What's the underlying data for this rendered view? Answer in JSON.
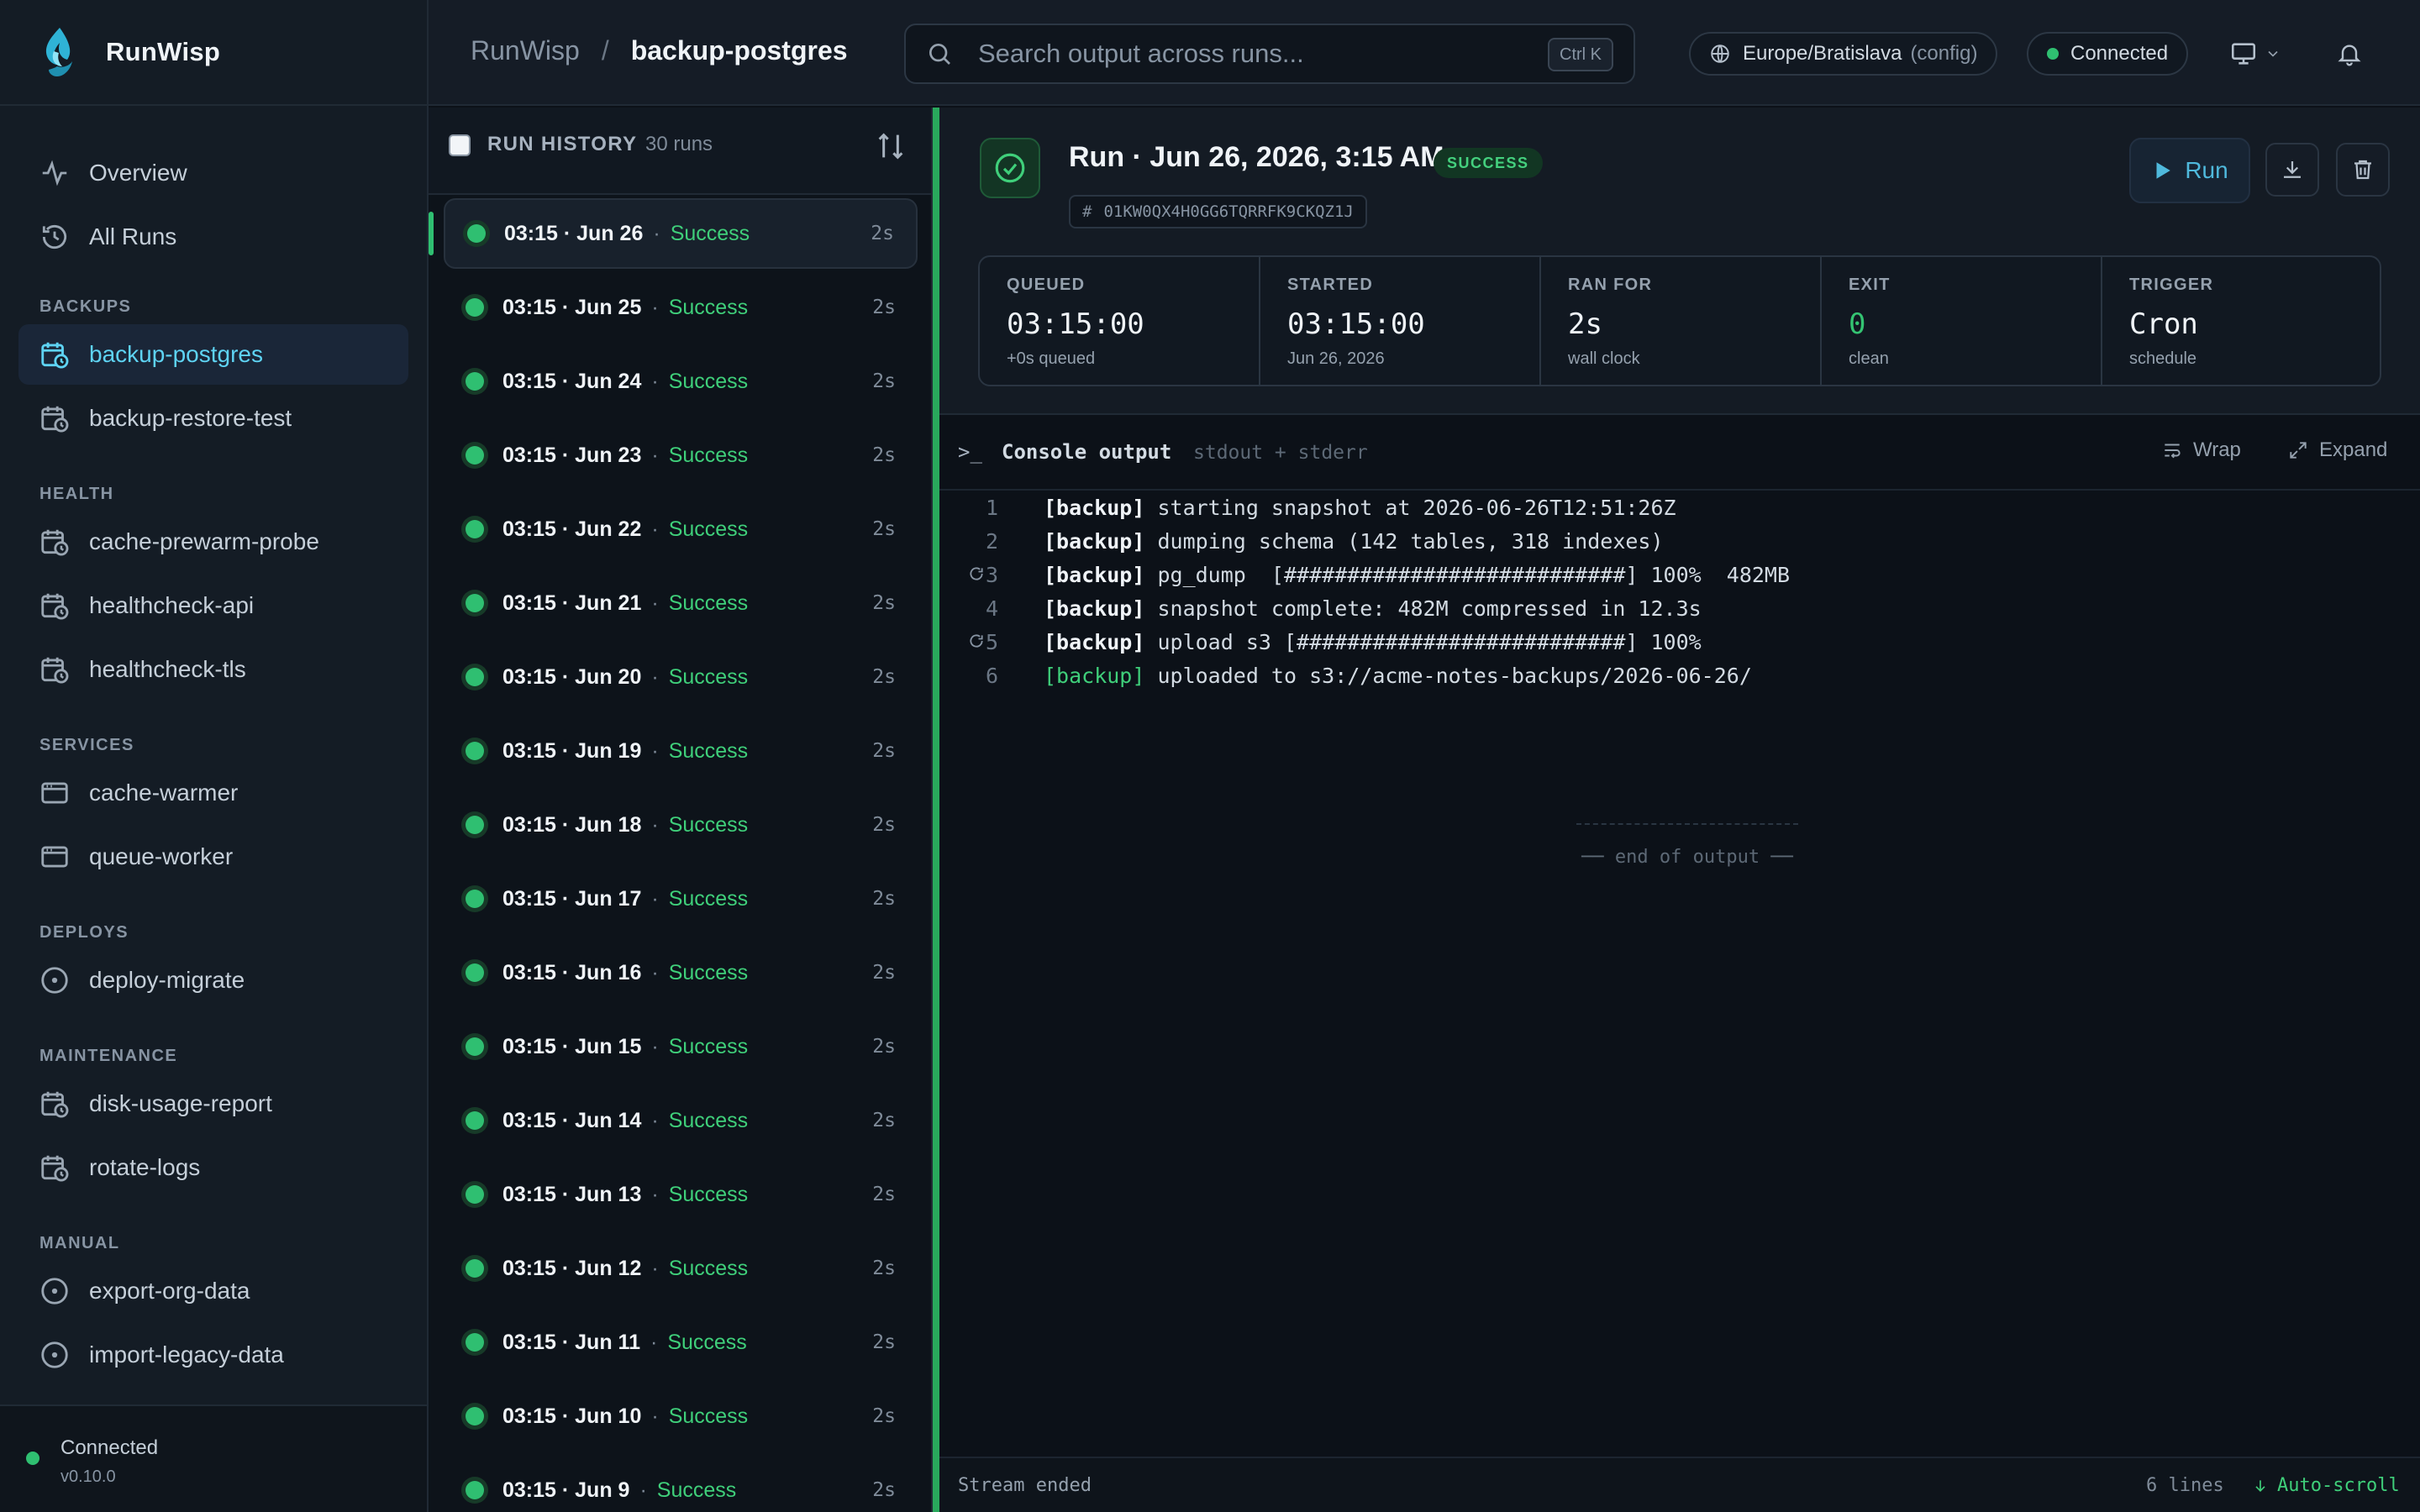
{
  "app": {
    "name": "RunWisp"
  },
  "sidebar": {
    "top_items": [
      {
        "label": "Overview",
        "icon": "activity-icon"
      },
      {
        "label": "All Runs",
        "icon": "history-icon"
      }
    ],
    "sections": [
      {
        "title": "BACKUPS",
        "items": [
          "backup-postgres",
          "backup-restore-test"
        ]
      },
      {
        "title": "HEALTH",
        "items": [
          "cache-prewarm-probe",
          "healthcheck-api",
          "healthcheck-tls"
        ]
      },
      {
        "title": "SERVICES",
        "items": [
          "cache-warmer",
          "queue-worker"
        ]
      },
      {
        "title": "DEPLOYS",
        "items": [
          "deploy-migrate"
        ]
      },
      {
        "title": "MAINTENANCE",
        "items": [
          "disk-usage-report",
          "rotate-logs"
        ]
      },
      {
        "title": "MANUAL",
        "items": [
          "export-org-data",
          "import-legacy-data"
        ]
      }
    ],
    "footer": {
      "status": "Connected",
      "version": "v0.10.0"
    }
  },
  "topbar": {
    "breadcrumb": {
      "root": "RunWisp",
      "separator": "/",
      "current": "backup-postgres"
    },
    "search": {
      "placeholder": "Search output across runs...",
      "shortcut": "Ctrl K"
    },
    "timezone": {
      "label": "Europe/Bratislava",
      "source": "(config)"
    },
    "connection": {
      "label": "Connected"
    }
  },
  "history": {
    "title": "RUN HISTORY",
    "count": "30 runs",
    "runs": [
      {
        "time": "03:15 · Jun 26",
        "status": "Success",
        "duration": "2s"
      },
      {
        "time": "03:15 · Jun 25",
        "status": "Success",
        "duration": "2s"
      },
      {
        "time": "03:15 · Jun 24",
        "status": "Success",
        "duration": "2s"
      },
      {
        "time": "03:15 · Jun 23",
        "status": "Success",
        "duration": "2s"
      },
      {
        "time": "03:15 · Jun 22",
        "status": "Success",
        "duration": "2s"
      },
      {
        "time": "03:15 · Jun 21",
        "status": "Success",
        "duration": "2s"
      },
      {
        "time": "03:15 · Jun 20",
        "status": "Success",
        "duration": "2s"
      },
      {
        "time": "03:15 · Jun 19",
        "status": "Success",
        "duration": "2s"
      },
      {
        "time": "03:15 · Jun 18",
        "status": "Success",
        "duration": "2s"
      },
      {
        "time": "03:15 · Jun 17",
        "status": "Success",
        "duration": "2s"
      },
      {
        "time": "03:15 · Jun 16",
        "status": "Success",
        "duration": "2s"
      },
      {
        "time": "03:15 · Jun 15",
        "status": "Success",
        "duration": "2s"
      },
      {
        "time": "03:15 · Jun 14",
        "status": "Success",
        "duration": "2s"
      },
      {
        "time": "03:15 · Jun 13",
        "status": "Success",
        "duration": "2s"
      },
      {
        "time": "03:15 · Jun 12",
        "status": "Success",
        "duration": "2s"
      },
      {
        "time": "03:15 · Jun 11",
        "status": "Success",
        "duration": "2s"
      },
      {
        "time": "03:15 · Jun 10",
        "status": "Success",
        "duration": "2s"
      },
      {
        "time": "03:15 · Jun 9",
        "status": "Success",
        "duration": "2s"
      }
    ]
  },
  "run": {
    "title": "Run · Jun 26, 2026, 3:15 AM",
    "badge": "SUCCESS",
    "id": "01KW0QX4H0GG6TQRRFK9CKQZ1J",
    "run_button": "Run",
    "stats": [
      {
        "label": "QUEUED",
        "value": "03:15:00",
        "sub": "+0s queued",
        "mono": true
      },
      {
        "label": "STARTED",
        "value": "03:15:00",
        "sub": "Jun 26, 2026",
        "mono": true
      },
      {
        "label": "RAN FOR",
        "value": "2s",
        "sub": "wall clock",
        "mono": true
      },
      {
        "label": "EXIT",
        "value": "0",
        "sub": "clean",
        "mono": true
      },
      {
        "label": "TRIGGER",
        "value": "Cron",
        "sub": "schedule",
        "mono": true
      }
    ]
  },
  "console": {
    "prompt": ">_",
    "title": "Console output",
    "subtitle": "stdout + stderr",
    "wrap_label": "Wrap",
    "expand_label": "Expand",
    "lines": [
      {
        "num": "1",
        "tag": "[backup]",
        "text": " starting snapshot at 2026-06-26T12:51:26Z",
        "retry": false,
        "tag_green": false
      },
      {
        "num": "2",
        "tag": "[backup]",
        "text": " dumping schema (142 tables, 318 indexes)",
        "retry": false,
        "tag_green": false
      },
      {
        "num": "3",
        "tag": "[backup]",
        "text": " pg_dump  [###########################] 100%  482MB",
        "retry": true,
        "tag_green": false
      },
      {
        "num": "4",
        "tag": "[backup]",
        "text": " snapshot complete: 482M compressed in 12.3s",
        "retry": false,
        "tag_green": false
      },
      {
        "num": "5",
        "tag": "[backup]",
        "text": " upload s3 [##########################] 100%",
        "retry": true,
        "tag_green": false
      },
      {
        "num": "6",
        "tag": "[backup]",
        "text": " uploaded to s3://acme-notes-backups/2026-06-26/",
        "retry": false,
        "tag_green": true
      }
    ],
    "end_marker": "── end of output ──",
    "footer": {
      "status": "Stream ended",
      "line_count": "6 lines",
      "autoscroll": "Auto-scroll"
    }
  }
}
